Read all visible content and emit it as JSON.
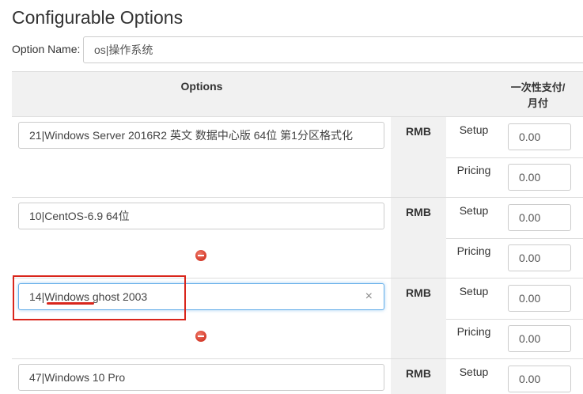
{
  "page": {
    "title": "Configurable Options"
  },
  "option_name": {
    "label": "Option Name:",
    "value": "os|操作系统"
  },
  "table": {
    "header_options": "Options",
    "header_cycle": "一次性支付/\n月付"
  },
  "rows": [
    {
      "name": "21|Windows Server 2016R2 英文 数据中心版 64位 第1分区格式化",
      "currency": "RMB",
      "setup_label": "Setup",
      "setup_value": "0.00",
      "pricing_label": "Pricing",
      "pricing_value": "0.00"
    },
    {
      "name": "10|CentOS-6.9 64位",
      "currency": "RMB",
      "setup_label": "Setup",
      "setup_value": "0.00",
      "pricing_label": "Pricing",
      "pricing_value": "0.00"
    },
    {
      "name": "14|Windows ghost 2003",
      "currency": "RMB",
      "setup_label": "Setup",
      "setup_value": "0.00",
      "pricing_label": "Pricing",
      "pricing_value": "0.00",
      "clear_icon": "×"
    },
    {
      "name": "47|Windows 10 Pro",
      "currency": "RMB",
      "setup_label": "Setup",
      "setup_value": "0.00"
    }
  ]
}
